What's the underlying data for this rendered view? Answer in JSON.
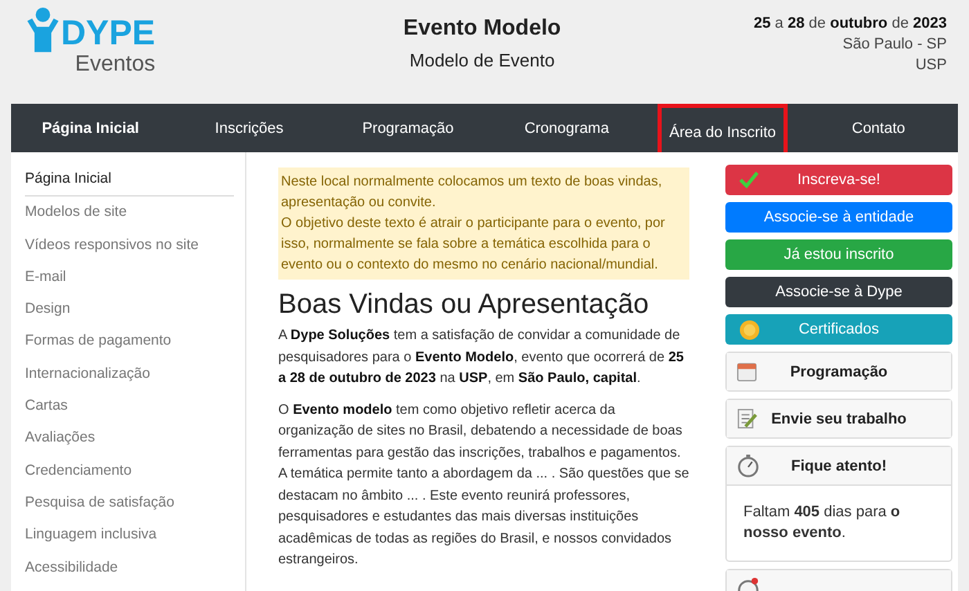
{
  "header": {
    "logo": {
      "name": "DYPE",
      "sub": "Eventos"
    },
    "title": "Evento Modelo",
    "subtitle": "Modelo de Evento",
    "dates": "**25** a **28** de **outubro** de **2023**",
    "city": "São Paulo - SP",
    "venue": "USP"
  },
  "nav": [
    {
      "label": "Página Inicial",
      "selected": true,
      "highlighted": false
    },
    {
      "label": "Inscrições",
      "selected": false,
      "highlighted": false
    },
    {
      "label": "Programação",
      "selected": false,
      "highlighted": false
    },
    {
      "label": "Cronograma",
      "selected": false,
      "highlighted": false
    },
    {
      "label": "Área do Inscrito",
      "selected": false,
      "highlighted": true
    },
    {
      "label": "Contato",
      "selected": false,
      "highlighted": false
    }
  ],
  "sidebar": {
    "items": [
      {
        "label": "Página Inicial",
        "selected": true
      },
      {
        "label": "Modelos de site",
        "selected": false
      },
      {
        "label": "Vídeos responsivos no site",
        "selected": false
      },
      {
        "label": "E-mail",
        "selected": false
      },
      {
        "label": "Design",
        "selected": false
      },
      {
        "label": "Formas de pagamento",
        "selected": false
      },
      {
        "label": "Internacionalização",
        "selected": false
      },
      {
        "label": "Cartas",
        "selected": false
      },
      {
        "label": "Avaliações",
        "selected": false
      },
      {
        "label": "Credenciamento",
        "selected": false
      },
      {
        "label": "Pesquisa de satisfação",
        "selected": false
      },
      {
        "label": "Linguagem inclusiva",
        "selected": false
      },
      {
        "label": "Acessibilidade",
        "selected": false
      }
    ]
  },
  "notice": [
    "Neste local normalmente colocamos um texto de boas vindas, apresentação ou convite.",
    "O objetivo deste texto é atrair o participante para o evento, por isso, normalmente se fala sobre a temática escolhida para o evento ou o contexto do mesmo no cenário nacional/mundial."
  ],
  "heading": "Boas Vindas ou Apresentação",
  "paragraphs": [
    "A **Dype Soluções** tem a satisfação de convidar a comunidade de pesquisadores para o **Evento Modelo**, evento que ocorrerá de **25 a 28 de outubro de 2023** na **USP**, em **São Paulo, capital**.",
    "O **Evento modelo** tem como objetivo refletir acerca da organização de sites no Brasil, debatendo a necessidade de boas ferramentas para gestão das inscrições, trabalhos e pagamentos. A temática permite tanto a abordagem da ... . São questões que se destacam no âmbito ... . Este evento reunirá professores, pesquisadores e estudantes das mais diversas instituições acadêmicas de todas as regiões do Brasil, e nossos convidados estrangeiros."
  ],
  "actions": [
    {
      "label": "Inscreva-se!",
      "kind": "danger"
    },
    {
      "label": "Associe-se à entidade",
      "kind": "primary"
    },
    {
      "label": "Já estou inscrito",
      "kind": "success"
    },
    {
      "label": "Associe-se à Dype",
      "kind": "dark"
    },
    {
      "label": "Certificados",
      "kind": "info"
    }
  ],
  "cards": [
    {
      "label": "Programação"
    },
    {
      "label": "Envie seu trabalho"
    },
    {
      "label": "Fique atento!",
      "body": "Faltam **405** dias para **o nosso evento**."
    }
  ]
}
